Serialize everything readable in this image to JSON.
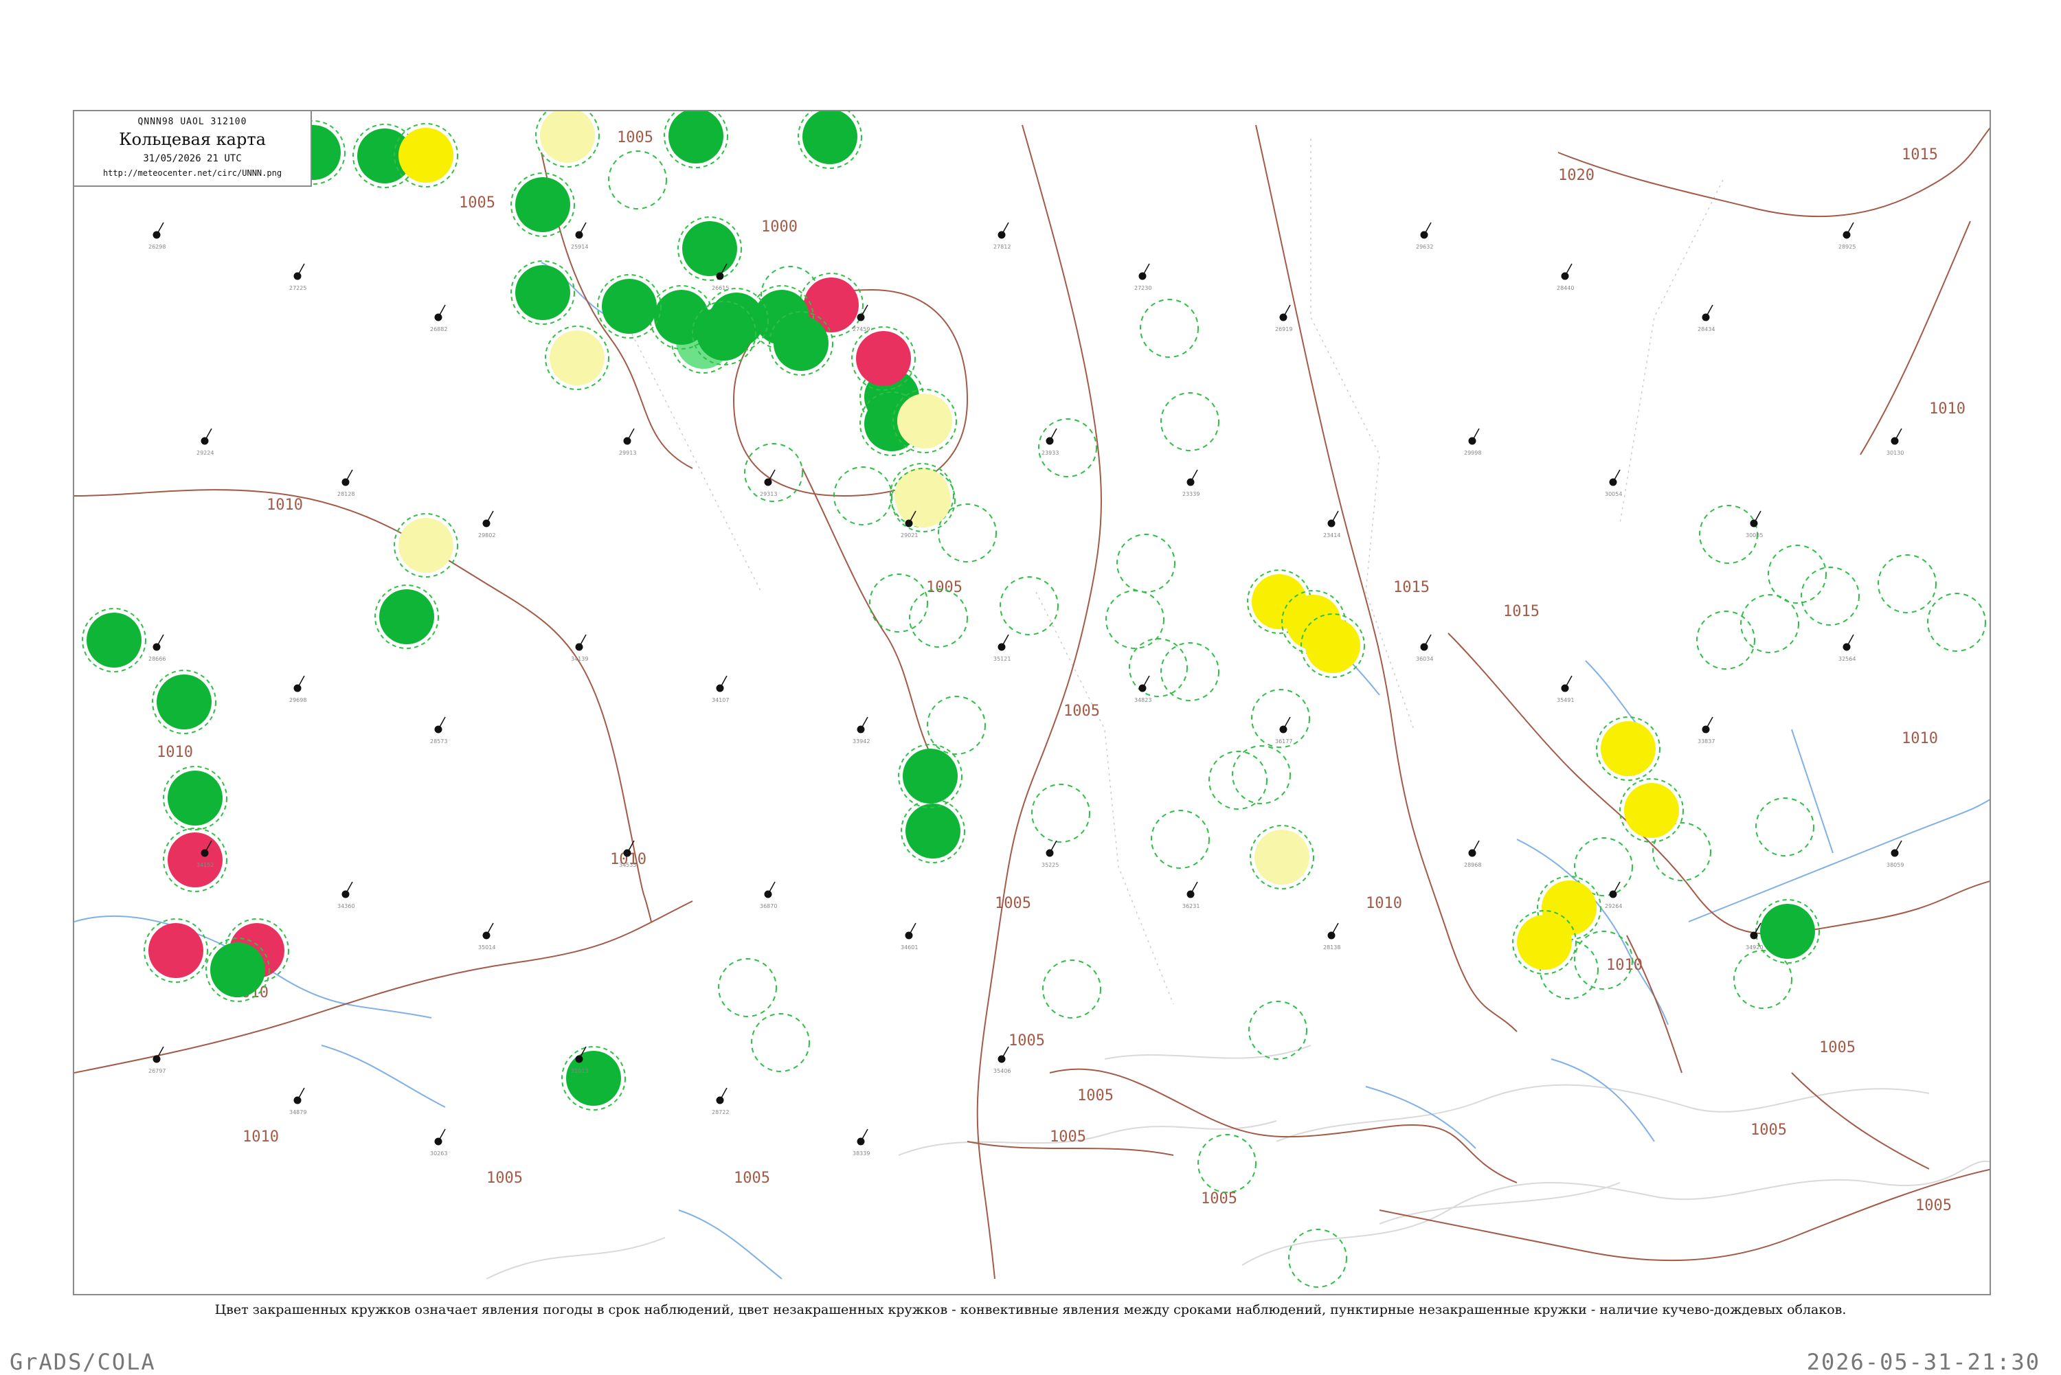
{
  "header": {
    "codes": "QNNN98  UAOL  312100",
    "title": "Кольцевая карта",
    "datetime": "31/05/2026 21 UTC",
    "url": "http://meteocenter.net/circ/UNNN.png"
  },
  "isobars": [
    "1000",
    "1005",
    "1005",
    "1005",
    "1005",
    "1005",
    "1005",
    "1005",
    "1005",
    "1005",
    "1005",
    "1005",
    "1010",
    "1010",
    "1010",
    "1010",
    "1010",
    "1010",
    "1010",
    "1010",
    "1010",
    "1015",
    "1015",
    "1015",
    "1020",
    "1005",
    "1005",
    "1005"
  ],
  "circles": {
    "filled": [
      {
        "color": "#0fb536"
      },
      {
        "color": "#0fb536"
      },
      {
        "color": "#f8f000"
      },
      {
        "color": "#0fb536"
      },
      {
        "color": "#f8f6a8"
      },
      {
        "color": "#0fb536"
      },
      {
        "color": "#0fb536"
      },
      {
        "color": "#0fb536"
      },
      {
        "color": "#e8315e"
      },
      {
        "color": "#0fb536"
      },
      {
        "color": "#0fb536"
      },
      {
        "color": "#6ee08a"
      },
      {
        "color": "#0fb536"
      },
      {
        "color": "#0fb536"
      },
      {
        "color": "#0fb536"
      },
      {
        "color": "#0fb536"
      },
      {
        "color": "#0fb536"
      },
      {
        "color": "#0fb536"
      },
      {
        "color": "#e8315e"
      },
      {
        "color": "#0fb536"
      },
      {
        "color": "#f8f6a8"
      },
      {
        "color": "#f8f6a8"
      },
      {
        "color": "#f8f6a8"
      },
      {
        "color": "#f8f6a8"
      },
      {
        "color": "#0fb536"
      },
      {
        "color": "#0fb536"
      },
      {
        "color": "#0fb536"
      },
      {
        "color": "#e8315e"
      },
      {
        "color": "#0fb536"
      },
      {
        "color": "#e8315e"
      },
      {
        "color": "#e8315e"
      },
      {
        "color": "#0fb536"
      },
      {
        "color": "#0fb536"
      },
      {
        "color": "#0fb536"
      },
      {
        "color": "#0fb536"
      },
      {
        "color": "#f8f6a8"
      },
      {
        "color": "#f8f000"
      },
      {
        "color": "#f8f000"
      },
      {
        "color": "#f8f000"
      },
      {
        "color": "#f8f000"
      },
      {
        "color": "#f8f000"
      },
      {
        "color": "#f8f000"
      },
      {
        "color": "#f8f000"
      },
      {
        "color": "#0fb536"
      },
      {
        "color": "#f8f6a8"
      }
    ],
    "dashed_count": 40
  },
  "stations": [
    "26298",
    "27225",
    "26882",
    "25914",
    "26615",
    "27459",
    "27812",
    "27230",
    "26919",
    "29632",
    "28440",
    "28434",
    "28925",
    "29224",
    "28128",
    "29802",
    "29913",
    "29313",
    "29021",
    "23933",
    "23339",
    "23414",
    "29998",
    "30054",
    "30035",
    "30130",
    "28666",
    "29698",
    "28573",
    "34139",
    "34107",
    "33942",
    "35121",
    "34823",
    "36177",
    "36034",
    "35491",
    "33837",
    "32564",
    "34152",
    "34360",
    "35014",
    "34535",
    "36870",
    "34601",
    "35225",
    "36231",
    "28138",
    "28968",
    "29264",
    "34920",
    "38059",
    "26797",
    "34879",
    "30263",
    "31013",
    "28722",
    "38339",
    "35406"
  ],
  "caption": "Цвет закрашенных кружков означает явления погоды в срок наблюдений, цвет незакрашенных кружков - конвективные явления между сроками наблюдений, пунктирные незакрашенные кружки - наличие кучево-дождевых облаков.",
  "footer": {
    "left": "GrADS/COLA",
    "right": "2026-05-31-21:30"
  },
  "colors": {
    "isobar": "#a35a47",
    "water": "#7fb0e8",
    "terrain": "#d9d9d9",
    "dashed": "#2fbf45"
  }
}
